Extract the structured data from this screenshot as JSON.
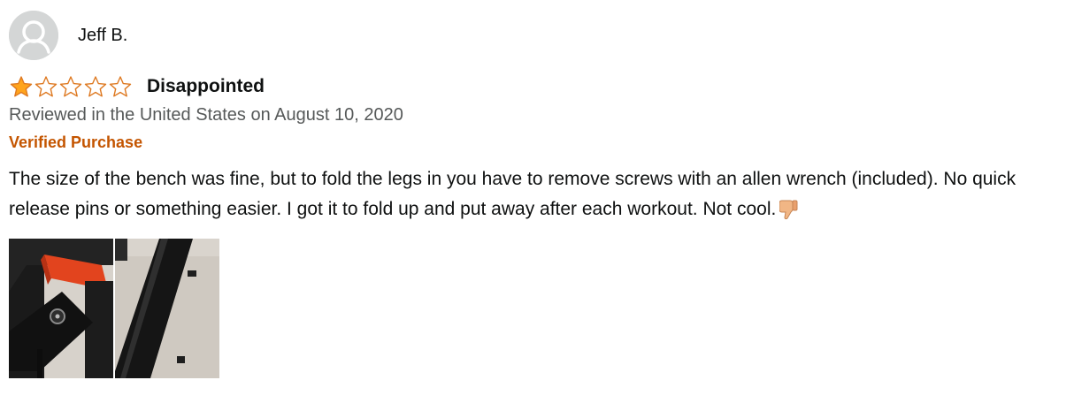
{
  "reviewer": {
    "name": "Jeff B.",
    "avatar_icon": "person-silhouette-icon"
  },
  "rating": {
    "value": 1,
    "max": 5,
    "filled_color": "#ffa41c",
    "empty_color": "#de7921"
  },
  "review": {
    "title": "Disappointed",
    "date_line": "Reviewed in the United States on August 10, 2020",
    "verified_label": "Verified Purchase",
    "body": "The size of the bench was fine, but to fold the legs in you have to remove screws with an allen wrench (included). No quick release pins or something easier. I got it to fold up and put away after each workout. Not cool.",
    "body_emoji": "thumbs-down-icon"
  },
  "images": [
    {
      "name": "review-image-1",
      "subject": "bench-leg-closeup"
    },
    {
      "name": "review-image-2",
      "subject": "folded-bench"
    }
  ],
  "colors": {
    "verified": "#c45500",
    "meta_text": "#565959",
    "text": "#0f1111"
  }
}
